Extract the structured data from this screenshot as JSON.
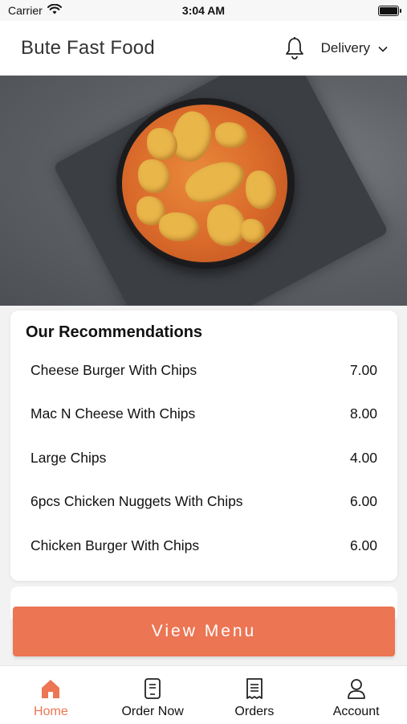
{
  "status_bar": {
    "carrier": "Carrier",
    "time": "3:04 AM"
  },
  "header": {
    "title": "Bute Fast Food",
    "delivery_label": "Delivery"
  },
  "hero": {
    "image": "chicken-curry-bowl-photo"
  },
  "recommendations": {
    "title": "Our Recommendations",
    "items": [
      {
        "name": "Cheese Burger With Chips",
        "price": "7.00"
      },
      {
        "name": "Mac N Cheese With Chips",
        "price": "8.00"
      },
      {
        "name": "Large Chips",
        "price": "4.00"
      },
      {
        "name": "6pcs Chicken Nuggets With Chips",
        "price": "6.00"
      },
      {
        "name": "Chicken Burger With Chips",
        "price": "6.00"
      }
    ]
  },
  "view_menu_label": "View Menu",
  "nav": {
    "items": [
      {
        "label": "Home",
        "icon": "home-icon",
        "active": true
      },
      {
        "label": "Order Now",
        "icon": "order-now-icon",
        "active": false
      },
      {
        "label": "Orders",
        "icon": "receipt-icon",
        "active": false
      },
      {
        "label": "Account",
        "icon": "person-icon",
        "active": false
      }
    ]
  },
  "colors": {
    "accent": "#ec7553",
    "background": "#f2f2f2",
    "card": "#ffffff"
  }
}
